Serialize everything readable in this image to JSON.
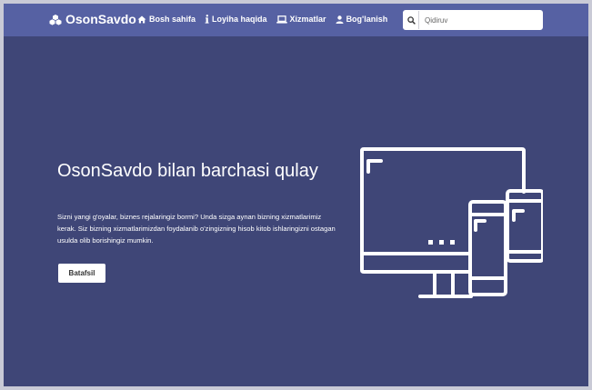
{
  "brand": {
    "name": "OsonSavdo",
    "icon": "cubes-icon"
  },
  "nav": [
    {
      "label": "Bosh sahifa",
      "icon": "home-icon"
    },
    {
      "label": "Loyiha haqida",
      "icon": "info-icon"
    },
    {
      "label": "Xizmatlar",
      "icon": "laptop-icon"
    },
    {
      "label": "Bog'lanish",
      "icon": "user-icon"
    }
  ],
  "search": {
    "placeholder": "Qidiruv",
    "icon": "search-icon"
  },
  "hero": {
    "title": "OsonSavdo bilan barchasi qulay",
    "text": "Sizni yangi g'oyalar, biznes rejalaringiz bormi? Unda sizga aynan bizning xizmatlarimiz kerak. Siz bizning xizmatlarimizdan foydalanib o'zingizning hisob kitob ishlaringizni ostagan usulda olib borishingiz mumkin.",
    "button": "Batafsil",
    "illustration": "devices-icon"
  },
  "colors": {
    "navbar": "#5661a3",
    "background": "#3f4677",
    "text": "#ffffff"
  }
}
